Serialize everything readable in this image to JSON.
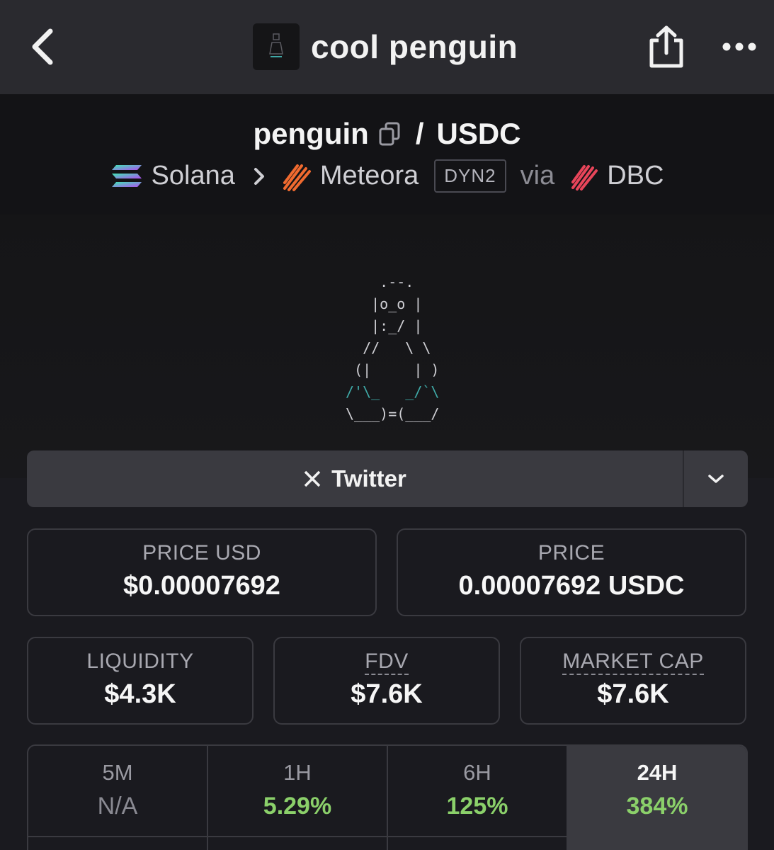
{
  "topbar": {
    "title": "cool penguin",
    "back_icon": "chevron-left-icon",
    "share_icon": "share-icon",
    "more_icon": "more-dots-icon"
  },
  "pair": {
    "base": "penguin",
    "separator": "/",
    "quote": "USDC"
  },
  "chain": {
    "name": "Solana",
    "dex": "Meteora",
    "dex_badge": "DYN2",
    "via": "via",
    "launchpad": "DBC"
  },
  "twitter": {
    "label": "Twitter"
  },
  "stats": {
    "price_usd": {
      "label": "PRICE USD",
      "value": "$0.00007692"
    },
    "price": {
      "label": "PRICE",
      "value": "0.00007692 USDC"
    },
    "liquidity": {
      "label": "LIQUIDITY",
      "value": "$4.3K"
    },
    "fdv": {
      "label": "FDV",
      "value": "$7.6K"
    },
    "market_cap": {
      "label": "MARKET CAP",
      "value": "$7.6K"
    }
  },
  "timeframes": [
    {
      "label": "5M",
      "value": "N/A"
    },
    {
      "label": "1H",
      "value": "5.29%"
    },
    {
      "label": "6H",
      "value": "125%"
    },
    {
      "label": "24H",
      "value": "384%"
    }
  ],
  "colors": {
    "positive": "#8bd06a",
    "background": "#1a1a1f",
    "topbar": "#2a2a2f"
  }
}
